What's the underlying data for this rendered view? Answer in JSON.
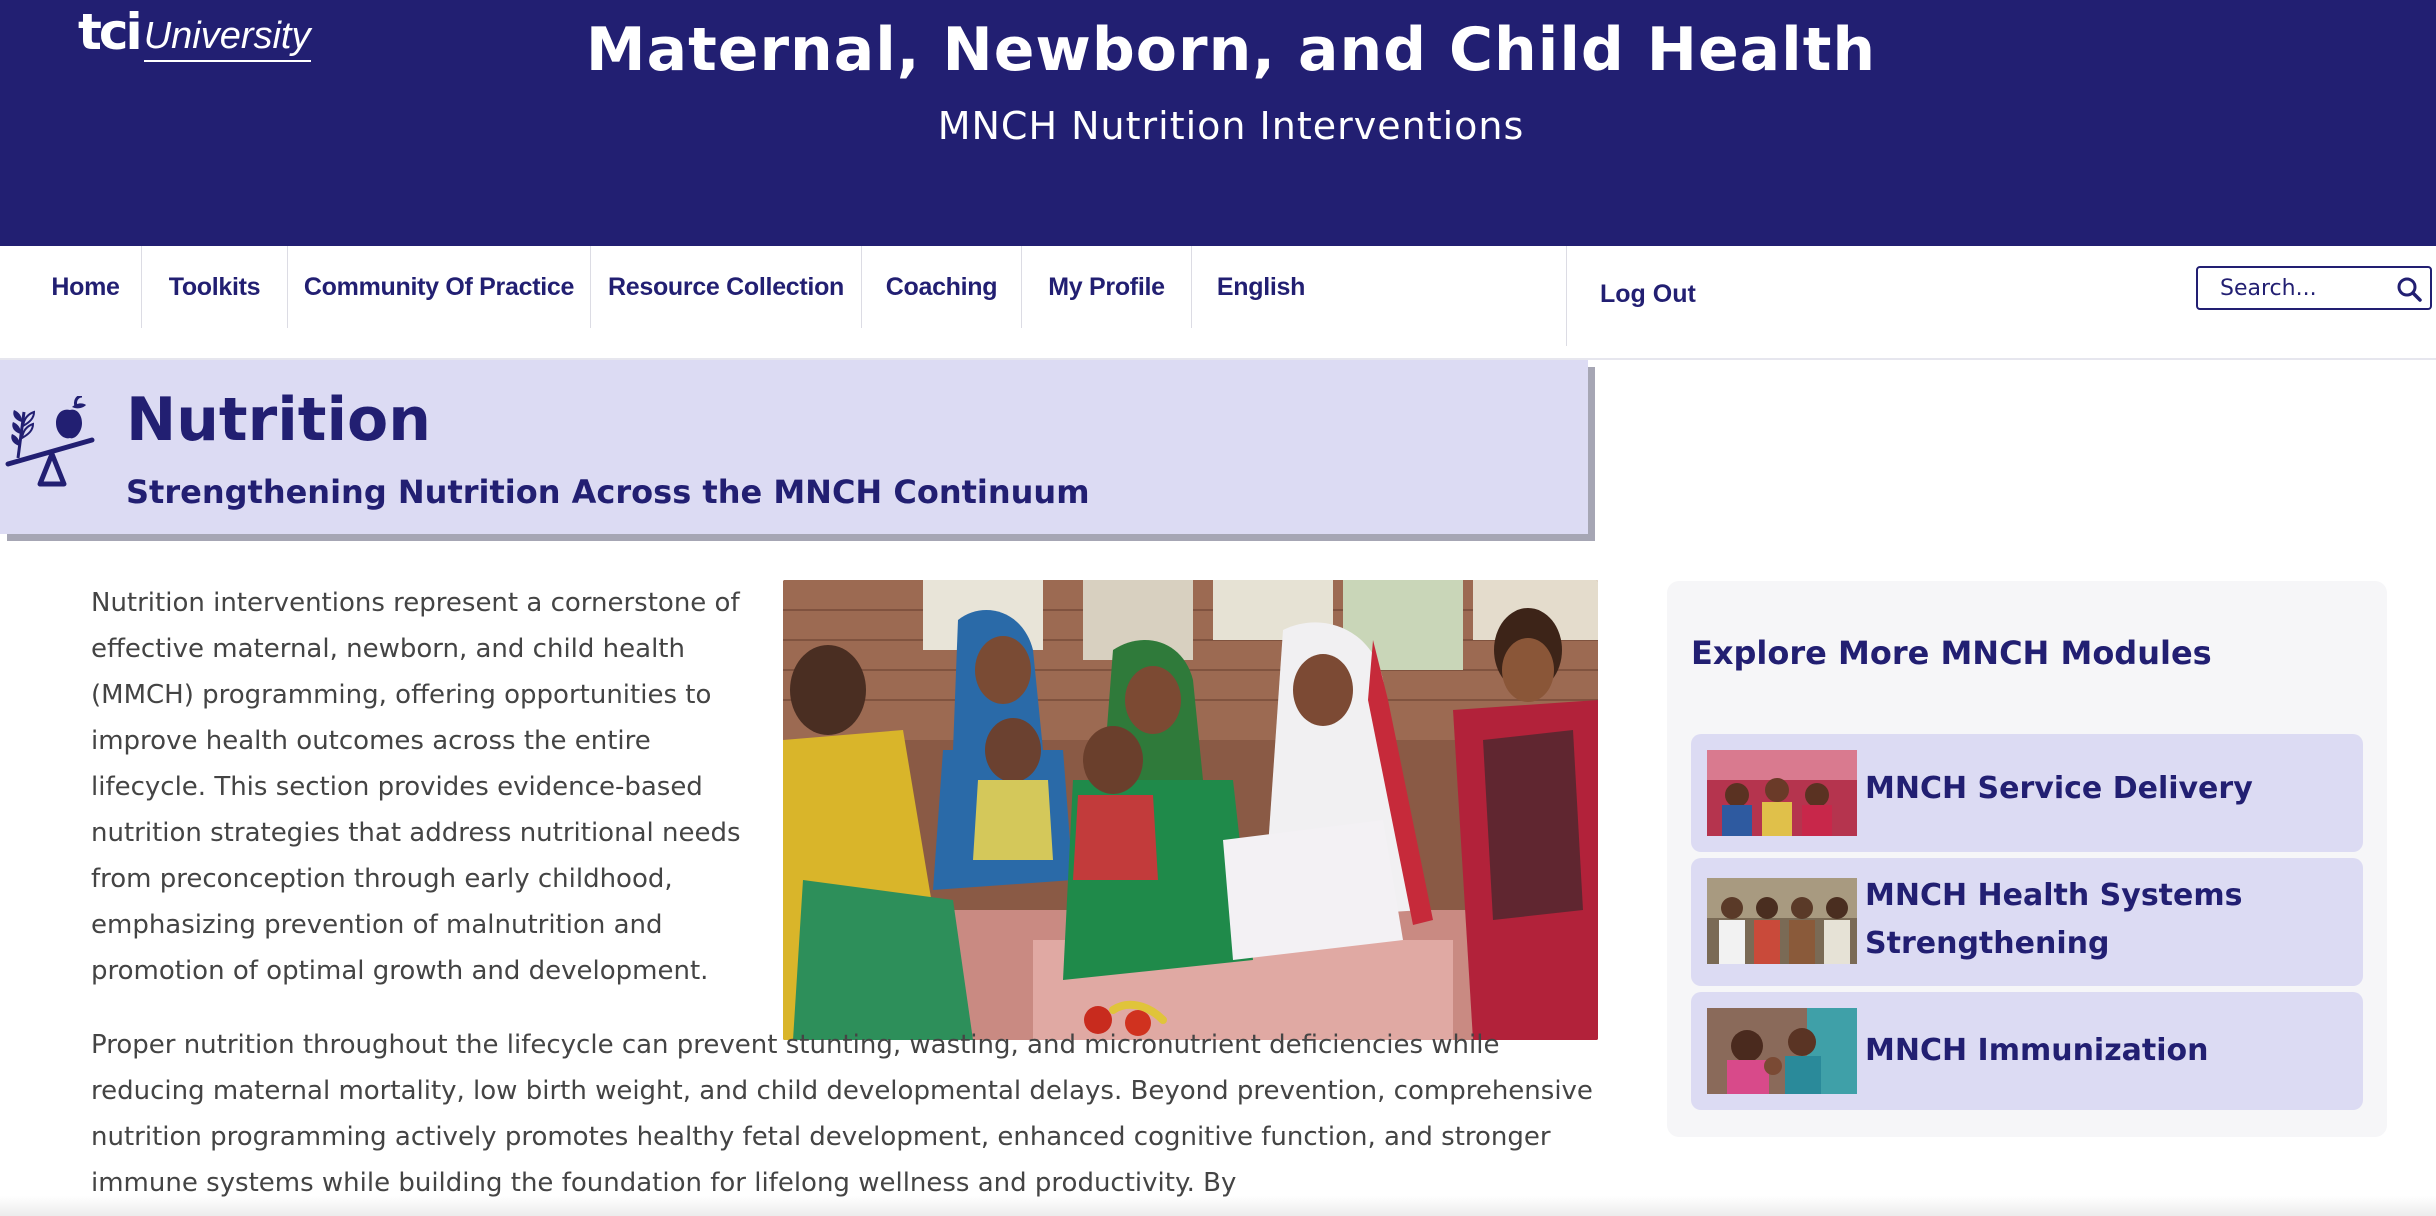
{
  "header": {
    "logo_main": "tci",
    "logo_sub": "University",
    "title": "Maternal, Newborn, and Child Health",
    "subtitle": "MNCH Nutrition Interventions"
  },
  "nav": {
    "items": [
      {
        "label": "Home"
      },
      {
        "label": "Toolkits"
      },
      {
        "label": "Community Of Practice"
      },
      {
        "label": "Resource Collection"
      },
      {
        "label": "Coaching"
      },
      {
        "label": "My Profile"
      },
      {
        "label": "English"
      }
    ],
    "logout_label": "Log Out",
    "search_placeholder": "Search..."
  },
  "banner": {
    "icon": "nutrition-scale-icon",
    "title": "Nutrition",
    "subtitle": "Strengthening Nutrition Across the MNCH Continuum"
  },
  "content": {
    "paragraph1": "Nutrition interventions represent a cornerstone of effective maternal, newborn, and child health (MMCH) programming, offering opportunities to improve health outcomes across the entire lifecycle. This section provides evidence-based nutrition strategies that address nutritional needs from preconception through early childhood, emphasizing prevention of malnutrition and promotion of optimal growth and development.",
    "paragraph2": "Proper nutrition throughout the lifecycle can prevent stunting, wasting, and micronutrient deficiencies while reducing maternal mortality, low birth weight, and child developmental delays. Beyond prevention, comprehensive nutrition programming actively promotes healthy fetal development, enhanced cognitive function, and stronger immune systems while building the foundation for lifelong wellness and productivity. By",
    "photo": "women-feeding-child-photo"
  },
  "sidebar": {
    "title": "Explore More MNCH Modules",
    "modules": [
      {
        "label": "MNCH Service Delivery"
      },
      {
        "label": "MNCH Health Systems Strengthening"
      },
      {
        "label": "MNCH Immunization"
      }
    ]
  },
  "colors": {
    "brand_navy": "#221f72",
    "banner_lavender": "#dcdbf3",
    "body_text": "#444444"
  }
}
